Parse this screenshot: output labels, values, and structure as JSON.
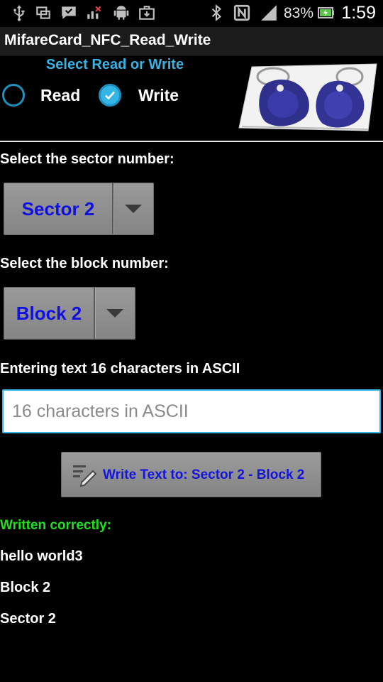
{
  "status_bar": {
    "battery_percent": "83%",
    "time": "1:59",
    "icons": [
      "usb-icon",
      "screen-mirror-icon",
      "message-icon",
      "signal-off-icon",
      "android-icon",
      "briefcase-download-icon",
      "bluetooth-icon",
      "nfc-icon",
      "cell-signal-icon",
      "battery-charging-icon"
    ]
  },
  "app": {
    "title": "MifareCard_NFC_Read_Write"
  },
  "mode": {
    "label": "Select Read or Write",
    "options": [
      "Read",
      "Write"
    ],
    "selected": "Write"
  },
  "sector": {
    "label": "Select the sector number:",
    "selected": "Sector 2"
  },
  "block": {
    "label": "Select the block number:",
    "selected": "Block 2"
  },
  "text_entry": {
    "label": "Entering text 16 characters in ASCII",
    "value": "",
    "placeholder": "16 characters in ASCII"
  },
  "write_button": {
    "label": "Write Text to: Sector 2 - Block 2"
  },
  "result": {
    "status": "Written correctly:",
    "text": "hello world3",
    "block": "Block 2",
    "sector": "Sector 2"
  },
  "colors": {
    "accent": "#33b5e5",
    "spinner_text": "#1010e0",
    "success": "#1fe01f"
  }
}
